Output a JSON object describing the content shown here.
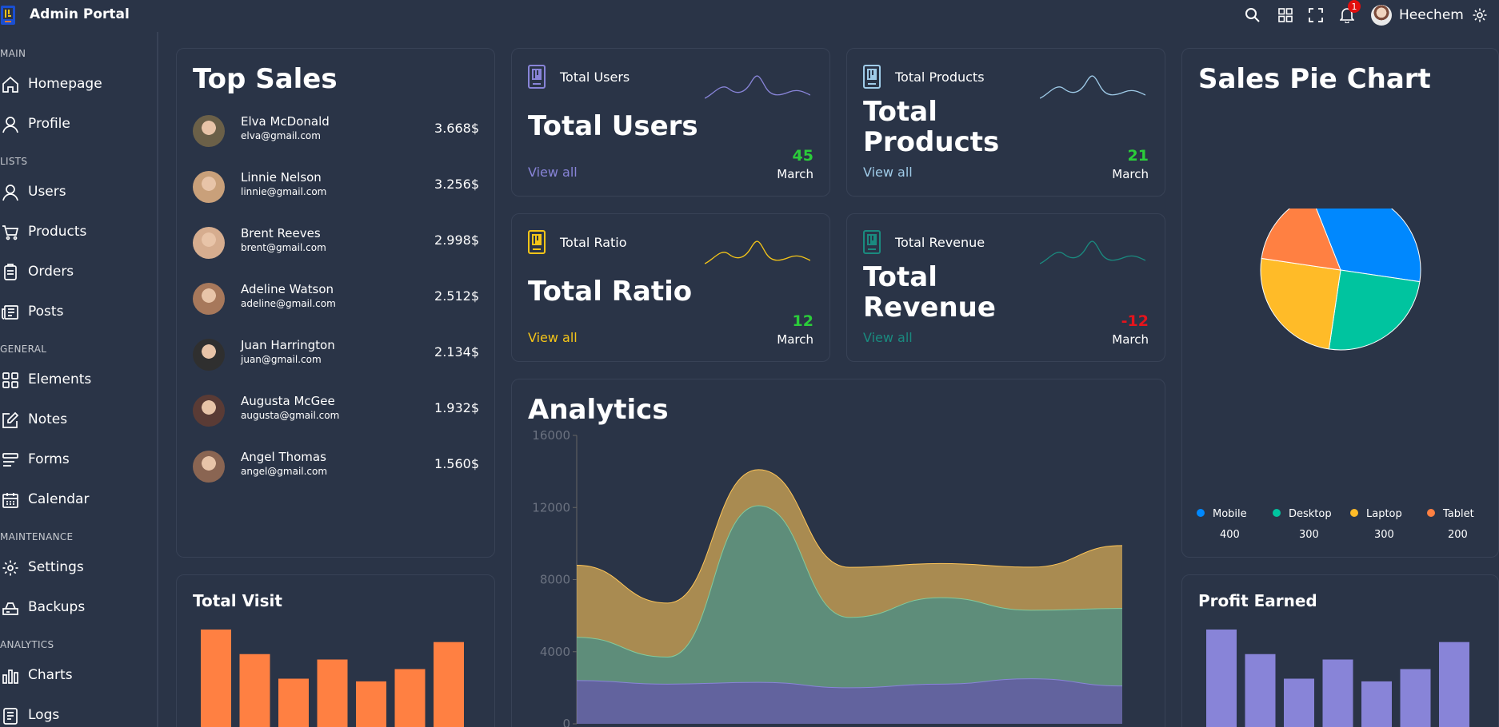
{
  "app": {
    "title": "Admin Portal"
  },
  "topbar": {
    "notification_count": "1",
    "username": "Heechem",
    "icons": [
      "search-icon",
      "apps-icon",
      "fullscreen-icon",
      "bell-icon",
      "settings-icon"
    ]
  },
  "sidebar": {
    "sections": [
      {
        "title": "MAIN",
        "items": [
          {
            "label": "Homepage",
            "icon": "home-icon"
          },
          {
            "label": "Profile",
            "icon": "user-icon"
          }
        ]
      },
      {
        "title": "LISTS",
        "items": [
          {
            "label": "Users",
            "icon": "user-icon"
          },
          {
            "label": "Products",
            "icon": "cart-icon"
          },
          {
            "label": "Orders",
            "icon": "clipboard-icon"
          },
          {
            "label": "Posts",
            "icon": "news-icon"
          }
        ]
      },
      {
        "title": "GENERAL",
        "items": [
          {
            "label": "Elements",
            "icon": "grid-icon"
          },
          {
            "label": "Notes",
            "icon": "edit-icon"
          },
          {
            "label": "Forms",
            "icon": "forms-icon"
          },
          {
            "label": "Calendar",
            "icon": "calendar-icon"
          }
        ]
      },
      {
        "title": "MAINTENANCE",
        "items": [
          {
            "label": "Settings",
            "icon": "gear-icon"
          },
          {
            "label": "Backups",
            "icon": "backup-icon"
          }
        ]
      },
      {
        "title": "ANALYTICS",
        "items": [
          {
            "label": "Charts",
            "icon": "chart-icon"
          },
          {
            "label": "Logs",
            "icon": "logs-icon"
          }
        ]
      }
    ]
  },
  "top_sales": {
    "title": "Top Sales",
    "rows": [
      {
        "name": "Elva McDonald",
        "email": "elva@gmail.com",
        "amount": "3.668$"
      },
      {
        "name": "Linnie Nelson",
        "email": "linnie@gmail.com",
        "amount": "3.256$"
      },
      {
        "name": "Brent Reeves",
        "email": "brent@gmail.com",
        "amount": "2.998$"
      },
      {
        "name": "Adeline Watson",
        "email": "adeline@gmail.com",
        "amount": "2.512$"
      },
      {
        "name": "Juan Harrington",
        "email": "juan@gmail.com",
        "amount": "2.134$"
      },
      {
        "name": "Augusta McGee",
        "email": "augusta@gmail.com",
        "amount": "1.932$"
      },
      {
        "name": "Angel Thomas",
        "email": "angel@gmail.com",
        "amount": "1.560$"
      }
    ]
  },
  "stat_boxes": [
    {
      "small_title": "Total Users",
      "big_title": "Total Users",
      "link": "View all",
      "number": "45",
      "month": "March",
      "color": "#8884d8",
      "number_color": "#2bcc3a"
    },
    {
      "small_title": "Total Products",
      "big_title": "Total Products",
      "link": "View all",
      "number": "21",
      "month": "March",
      "color": "#9fcbe8",
      "number_color": "#2bcc3a"
    },
    {
      "small_title": "Total Ratio",
      "big_title": "Total Ratio",
      "link": "View all",
      "number": "12",
      "month": "March",
      "color": "#f5c518",
      "number_color": "#2bcc3a"
    },
    {
      "small_title": "Total Revenue",
      "big_title": "Total Revenue",
      "link": "View all",
      "number": "-12",
      "month": "March",
      "color": "#1a8a7f",
      "number_color": "#e5141c"
    }
  ],
  "pie": {
    "title": "Sales Pie Chart",
    "legend": [
      {
        "name": "Mobile",
        "value": "400",
        "color": "#0088fe"
      },
      {
        "name": "Desktop",
        "value": "300",
        "color": "#00c49f"
      },
      {
        "name": "Laptop",
        "value": "300",
        "color": "#ffbb28"
      },
      {
        "name": "Tablet",
        "value": "200",
        "color": "#ff8042"
      }
    ]
  },
  "analytics": {
    "title": "Analytics"
  },
  "total_visit": {
    "title": "Total Visit",
    "color": "#ff8042"
  },
  "profit_earned": {
    "title": "Profit Earned",
    "color": "#8884d8"
  },
  "chart_data": [
    {
      "type": "pie",
      "title": "Sales Pie Chart",
      "categories": [
        "Mobile",
        "Desktop",
        "Laptop",
        "Tablet"
      ],
      "values": [
        400,
        300,
        300,
        200
      ],
      "colors": [
        "#0088fe",
        "#00c49f",
        "#ffbb28",
        "#ff8042"
      ],
      "legend": "bottom"
    },
    {
      "type": "area",
      "title": "Analytics",
      "x": [
        "1",
        "2",
        "3",
        "4",
        "5",
        "6",
        "7"
      ],
      "ylim": [
        0,
        16000
      ],
      "yticks": [
        0,
        4000,
        8000,
        12000,
        16000
      ],
      "stacked": true,
      "series": [
        {
          "values": [
            2400,
            2200,
            2300,
            2000,
            2200,
            2500,
            2100
          ],
          "color": "#8884d8"
        },
        {
          "values": [
            2400,
            1500,
            9800,
            3900,
            4800,
            3800,
            4300
          ],
          "color": "#82ca9d"
        },
        {
          "values": [
            4000,
            3000,
            2000,
            2780,
            1890,
            2390,
            3490
          ],
          "color": "#ffc658"
        }
      ]
    },
    {
      "type": "bar",
      "title": "Total Visit",
      "values": [
        4000,
        3000,
        2000,
        2780,
        1890,
        2390,
        3490
      ],
      "color": "#ff8042"
    },
    {
      "type": "bar",
      "title": "Profit Earned",
      "values": [
        4000,
        3000,
        2000,
        2780,
        1890,
        2390,
        3490
      ],
      "color": "#8884d8"
    }
  ]
}
